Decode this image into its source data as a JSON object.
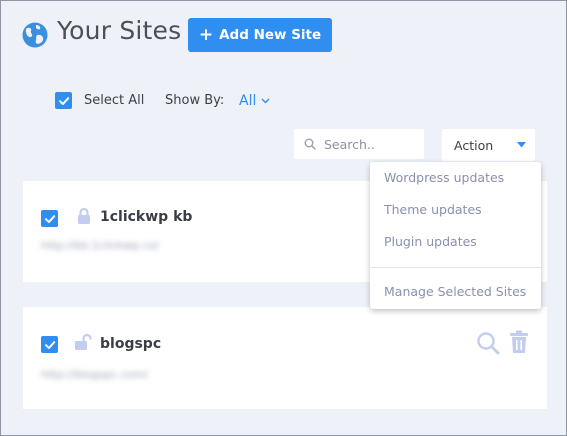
{
  "header": {
    "title": "Your Sites",
    "add_button_label": "Add New Site"
  },
  "filters": {
    "select_all_label": "Select All",
    "select_all_checked": true,
    "show_by_label": "Show By:",
    "show_by_value": "All"
  },
  "search": {
    "placeholder": "Search..",
    "value": ""
  },
  "action": {
    "label": "Action"
  },
  "dropdown": {
    "items": [
      "Wordpress updates",
      "Theme updates",
      "Plugin updates"
    ],
    "footer_item": "Manage Selected Sites"
  },
  "sites": [
    {
      "name": "1clickwp kb",
      "url": "http://kb.1clickwp.co/",
      "checked": true,
      "lock": "locked"
    },
    {
      "name": "blogspc",
      "url": "http://blogspc.com/",
      "checked": true,
      "lock": "unlocked"
    }
  ],
  "colors": {
    "accent": "#2f8ef0",
    "background": "#eef1f8",
    "muted_icon": "#c2cdf0"
  }
}
